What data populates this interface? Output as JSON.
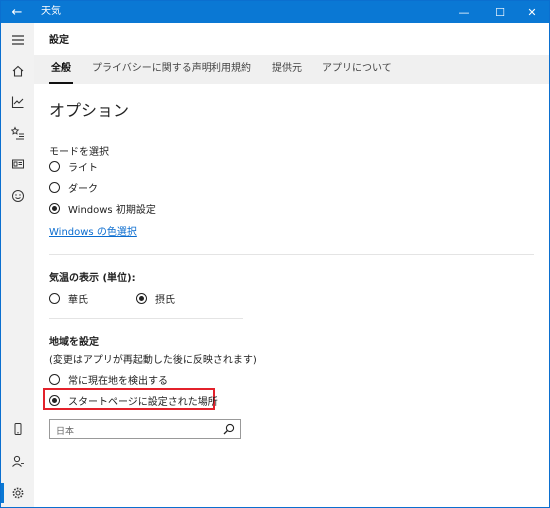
{
  "window": {
    "title": "天気",
    "back_glyph": "←",
    "min_glyph": "—",
    "max_glyph": "☐",
    "close_glyph": "✕"
  },
  "rail": {
    "items": [
      {
        "name": "hamburger-icon"
      },
      {
        "name": "home-icon"
      },
      {
        "name": "chart-icon"
      },
      {
        "name": "favorites-icon"
      },
      {
        "name": "news-icon"
      },
      {
        "name": "smiley-icon"
      },
      {
        "name": "phone-icon"
      },
      {
        "name": "account-icon"
      },
      {
        "name": "gear-icon"
      }
    ],
    "accent": "#0a78d4"
  },
  "header": {
    "page_title": "設定"
  },
  "tabs": [
    {
      "label": "全般"
    },
    {
      "label": "プライバシーに関する声明"
    },
    {
      "label": "利用規約"
    },
    {
      "label": "提供元"
    },
    {
      "label": "アプリについて"
    }
  ],
  "options": {
    "heading": "オプション",
    "mode_label": "モードを選択",
    "modes": [
      {
        "label": "ライト",
        "selected": false
      },
      {
        "label": "ダーク",
        "selected": false
      },
      {
        "label": "Windows 初期設定",
        "selected": true
      }
    ],
    "color_link": "Windows の色選択"
  },
  "temperature": {
    "label": "気温の表示 (単位):",
    "units": [
      {
        "label": "華氏",
        "selected": false
      },
      {
        "label": "摂氏",
        "selected": true
      }
    ]
  },
  "region": {
    "label": "地域を設定",
    "note": "(変更はアプリが再起動した後に反映されます)",
    "choices": [
      {
        "label": "常に現在地を検出する",
        "selected": false
      },
      {
        "label": "スタートページに設定された場所",
        "selected": true
      }
    ],
    "search_placeholder": "日本",
    "highlight_color": "#e3212b"
  }
}
